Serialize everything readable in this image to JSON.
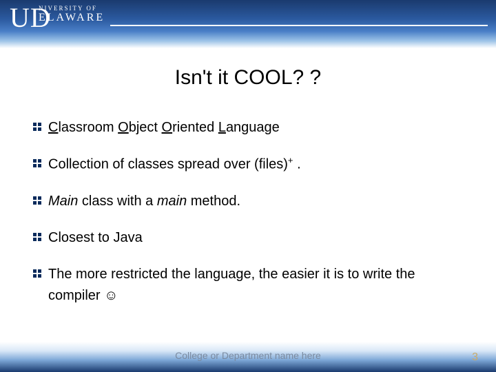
{
  "logo": {
    "big": "UD",
    "top_small": "NIVERSITY OF",
    "bottom_small": "ELAWARE"
  },
  "title": "Isn't it COOL? ?",
  "bullets": {
    "item1_html": "<span class='u'>C</span>lassroom <span class='u'>O</span>bject <span class='u'>O</span>riented <span class='u'>L</span>anguage",
    "item2_pre": "Collection of classes spread over (files)",
    "item2_sup": "+",
    "item2_post": " .",
    "item3_html": "<span class='em'>Main</span> class with a <span class='em'>main</span> method.",
    "item4": "Closest to Java",
    "item5": "The more restricted the language, the easier it is to write the compiler ☺"
  },
  "footer": {
    "dept": "College or Department name here",
    "page": "3"
  }
}
